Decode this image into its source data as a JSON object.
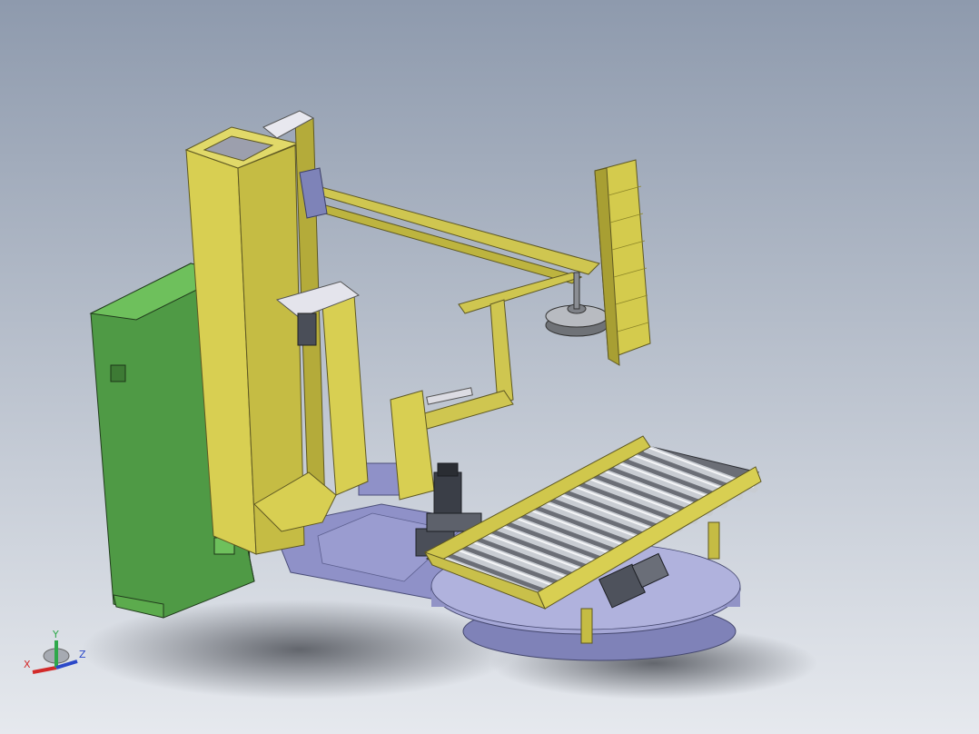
{
  "viewport": {
    "background_top": "#8e9aad",
    "background_bottom": "#e6e9ee"
  },
  "colors": {
    "frame_yellow": "#d8cf52",
    "frame_yellow_dark": "#9f9632",
    "cabinet_green": "#4f9a45",
    "cabinet_green_light": "#6ec05c",
    "base_plate": "#8f91c8",
    "turntable": "#a5a7d6",
    "roller": "#c8ccd2",
    "motor": "#3a3e47"
  },
  "triad": {
    "x_label": "X",
    "y_label": "Y",
    "z_label": "Z",
    "x_color": "#d22a2a",
    "y_color": "#2ea84a",
    "z_color": "#2b48c8"
  }
}
